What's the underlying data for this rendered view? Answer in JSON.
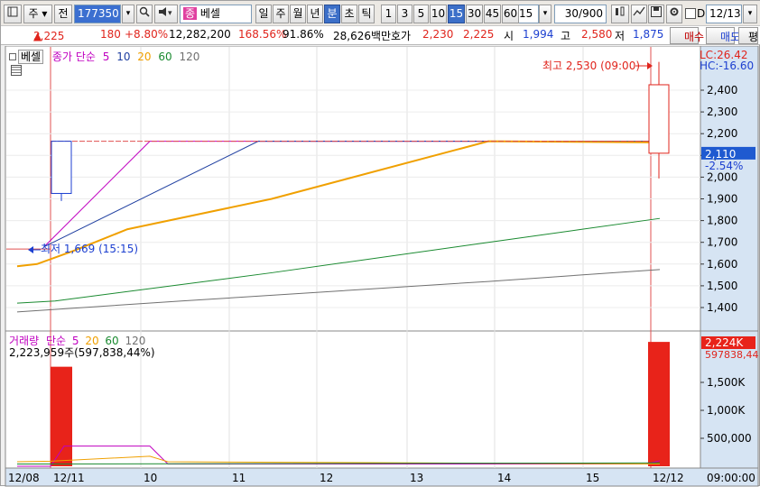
{
  "toolbar": {
    "market": "주",
    "mode": "전",
    "code": "177350",
    "name": "베셀",
    "name_badge": "종",
    "periods": [
      "일",
      "주",
      "월",
      "년",
      "분",
      "초",
      "틱"
    ],
    "active_period": "분",
    "intervals": [
      "1",
      "3",
      "5",
      "10",
      "15",
      "30",
      "45",
      "60"
    ],
    "active_interval": "15",
    "interval_select": "15",
    "count": "30",
    "count_total": "/900",
    "date_checkbox_label": "D",
    "date": "12/13"
  },
  "quote": {
    "price": "2,225",
    "arrow": "▲",
    "change": "180",
    "change_pct": "+8.80%",
    "volume": "12,282,200",
    "volume_ratio": "168.56%",
    "turnover": "91.86%",
    "amount": "28,626백만",
    "ask_label": "호가",
    "ask": "2,230",
    "bid": "2,225",
    "open_label": "시",
    "open": "1,994",
    "high_label": "고",
    "high": "2,580",
    "low_label": "저",
    "low": "1,875",
    "buy_button": "매수",
    "sell_button": "매도",
    "eval_button": "평"
  },
  "price_panel": {
    "name_tag": "베셀",
    "legend_title": "종가 단순",
    "ma_periods": [
      "5",
      "10",
      "20",
      "60",
      "120"
    ],
    "ma_colors": [
      "#c000c0",
      "#1f3fa0",
      "#f0a000",
      "#1a8a30",
      "#707070"
    ],
    "lc_label": "LC:26.42",
    "hc_label": "HC:-16.60",
    "high_annotation": "최고 2,530 (09:00)",
    "low_annotation": "최저 1,669 (15:15)",
    "current_price_tag": "2,110",
    "current_pct_tag": "-2.54%",
    "y_ticks": [
      "2,400",
      "2,300",
      "2,200",
      "2,100",
      "2,000",
      "1,900",
      "1,800",
      "1,700",
      "1,600",
      "1,500",
      "1,400"
    ]
  },
  "volume_panel": {
    "legend_title": "거래량",
    "legend_sub": "단순",
    "ma_periods": [
      "5",
      "20",
      "60",
      "120"
    ],
    "summary": "2,223,959주(597,838,44%)",
    "current_tag": "2,224K",
    "current_sub": "597838,44",
    "y_ticks": [
      "1,500K",
      "1,000K",
      "500,000"
    ]
  },
  "x_axis": {
    "labels": [
      "12/08",
      "12/11",
      "10",
      "11",
      "12",
      "13",
      "14",
      "15",
      "12/12"
    ],
    "time_label": "09:00:00"
  },
  "chart_data": {
    "type": "candlestick",
    "price_ylim": [
      1340,
      2530
    ],
    "candles": [
      {
        "x": "12/08 15:15",
        "open": 1669,
        "high": 1669,
        "low": 1669,
        "close": 1669
      },
      {
        "x": "12/11 09:00",
        "open": 2165,
        "high": 2165,
        "low": 1890,
        "close": 1925
      },
      {
        "x": "12/12 09:00",
        "open": 2110,
        "high": 2530,
        "low": 1994,
        "close": 2425
      }
    ],
    "volume_ylim": [
      0,
      2300000
    ],
    "volumes": [
      {
        "x": "12/11 09:00",
        "value": 1780000
      },
      {
        "x": "12/12 09:00",
        "value": 2223959
      }
    ]
  }
}
